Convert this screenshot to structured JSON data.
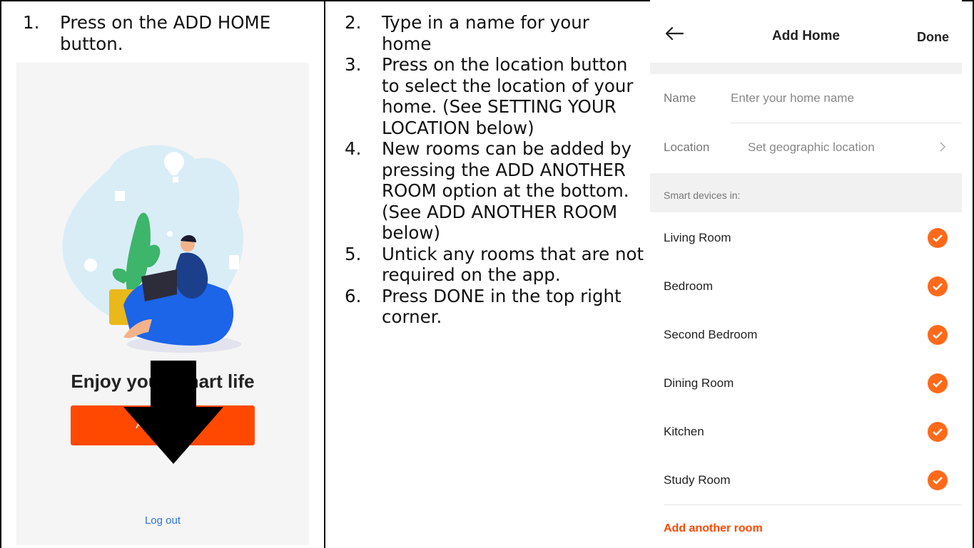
{
  "column1": {
    "step_num": "1.",
    "step_text": "Press on the ADD HOME button.",
    "enjoy_text": "Enjoy your smart life",
    "add_home_button": "Add Home",
    "logout": "Log out"
  },
  "column2": {
    "steps": [
      {
        "num": "2.",
        "text": "Type in a name for your home"
      },
      {
        "num": "3.",
        "text": "Press on the location button to select the location of your home.  (See SETTING YOUR LOCATION below)"
      },
      {
        "num": "4.",
        "text": "New rooms can be added by pressing the ADD ANOTHER ROOM option at the bottom. (See ADD ANOTHER ROOM below)"
      },
      {
        "num": "5.",
        "text": "Untick any rooms that are not required on the app."
      },
      {
        "num": "6.",
        "text": "Press DONE in the top right corner."
      }
    ]
  },
  "add_home_screen": {
    "title": "Add Home",
    "done": "Done",
    "name_label": "Name",
    "name_placeholder": "Enter your home name",
    "location_label": "Location",
    "location_value": "Set geographic location",
    "section_label": "Smart devices in:",
    "rooms": [
      "Living Room",
      "Bedroom",
      "Second Bedroom",
      "Dining Room",
      "Kitchen",
      "Study Room"
    ],
    "add_room": "Add another room",
    "accent_color": "#ff4800"
  },
  "icons": [
    "back-arrow-icon",
    "chevron-right-icon",
    "check-icon",
    "down-arrow-icon"
  ]
}
